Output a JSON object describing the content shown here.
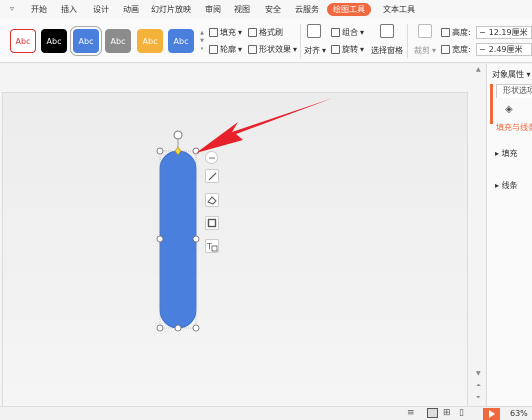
{
  "menu": {
    "tabs": [
      {
        "label": "开始",
        "active": false
      },
      {
        "label": "插入",
        "active": false
      },
      {
        "label": "设计",
        "active": false
      },
      {
        "label": "动画",
        "active": false
      },
      {
        "label": "幻灯片放映",
        "active": false
      },
      {
        "label": "审阅",
        "active": false
      },
      {
        "label": "视图",
        "active": false
      },
      {
        "label": "安全",
        "active": false
      },
      {
        "label": "云服务",
        "active": false
      },
      {
        "label": "绘图工具",
        "active": true
      },
      {
        "label": "文本工具",
        "active": false
      }
    ],
    "accent_color": "#f0693e"
  },
  "ribbon": {
    "styles": [
      {
        "label": "Abc",
        "bg": "#ffffff",
        "fg": "#e03030",
        "border": "#e03030",
        "selected": false
      },
      {
        "label": "Abc",
        "bg": "#000000",
        "fg": "#ffffff",
        "border": "#000000",
        "selected": false
      },
      {
        "label": "Abc",
        "bg": "#4a7fde",
        "fg": "#ffffff",
        "border": "#4a7fde",
        "selected": true
      },
      {
        "label": "Abc",
        "bg": "#8c8c8c",
        "fg": "#ffffff",
        "border": "#8c8c8c",
        "selected": false
      },
      {
        "label": "Abc",
        "bg": "#f5b23b",
        "fg": "#ffffff",
        "border": "#f5b23b",
        "selected": false
      },
      {
        "label": "Abc",
        "bg": "#4a7fde",
        "fg": "#ffffff",
        "border": "#4a7fde",
        "selected": false
      }
    ],
    "fill_label": "填充",
    "format_brush_label": "格式刷",
    "outline_label": "轮廓",
    "shape_effects_label": "形状效果",
    "align_label": "对齐",
    "group_label": "组合",
    "rotate_label": "旋转",
    "selection_pane_label": "选择窗格",
    "crop_label": "裁剪",
    "height_label": "高度:",
    "height_value": "12.19厘米",
    "width_label": "宽度:",
    "width_value": "2.49厘米"
  },
  "pane": {
    "title": "对象属性",
    "tab_label": "形状选项",
    "sub_label": "填充与线条",
    "sections": [
      "填充",
      "线条"
    ]
  },
  "shape": {
    "fill_color": "#4a7fde",
    "stroke_color": "#3a6fd0"
  },
  "arrow_color": "#e8202a",
  "status": {
    "zoom": "63%"
  }
}
